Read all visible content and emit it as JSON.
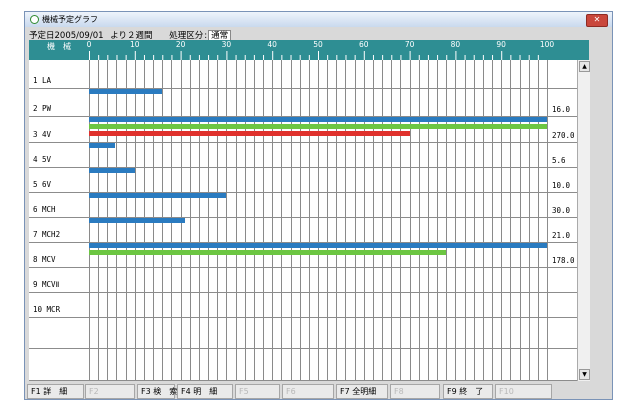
{
  "window": {
    "title": "機械予定グラフ",
    "close_icon": "close-icon"
  },
  "info": {
    "date_label": "予定日",
    "date": "2005/09/01",
    "period": "より２週間",
    "category_label": "処理区分",
    "category_value": "通常"
  },
  "grid": {
    "header_label": "機　械",
    "scale_labels": [
      "0",
      "10",
      "20",
      "30",
      "40",
      "50",
      "60",
      "70",
      "80",
      "90",
      "100"
    ],
    "colors": {
      "header": "#2e8e93",
      "blue": "#2a7bc0",
      "green": "#6cc642",
      "red": "#e0312d"
    },
    "rows": [
      {
        "label": "1 LA",
        "value": "",
        "bars": []
      },
      {
        "label": "2 PW",
        "value": "16.0",
        "bars": [
          {
            "color": "blue",
            "percent": 16
          }
        ]
      },
      {
        "label": "3 4V",
        "value": "270.0",
        "bars": [
          {
            "color": "blue",
            "percent": 100
          },
          {
            "color": "green",
            "percent": 100
          },
          {
            "color": "red",
            "percent": 70
          }
        ]
      },
      {
        "label": "4 5V",
        "value": "5.6",
        "bars": [
          {
            "color": "blue",
            "percent": 5.6
          }
        ]
      },
      {
        "label": "5 6V",
        "value": "10.0",
        "bars": [
          {
            "color": "blue",
            "percent": 10
          }
        ]
      },
      {
        "label": "6 MCH",
        "value": "30.0",
        "bars": [
          {
            "color": "blue",
            "percent": 30
          }
        ]
      },
      {
        "label": "7 MCH2",
        "value": "21.0",
        "bars": [
          {
            "color": "blue",
            "percent": 21
          }
        ]
      },
      {
        "label": "8 MCV",
        "value": "178.0",
        "bars": [
          {
            "color": "blue",
            "percent": 100
          },
          {
            "color": "green",
            "percent": 78
          }
        ]
      },
      {
        "label": "9 MCVⅡ",
        "value": "",
        "bars": []
      },
      {
        "label": "10 MCR",
        "value": "",
        "bars": []
      },
      {
        "label": "",
        "value": "",
        "bars": []
      },
      {
        "label": "",
        "value": "",
        "bars": []
      }
    ]
  },
  "function_keys": [
    {
      "label": "F1 詳　細",
      "enabled": true
    },
    {
      "label": "F2",
      "enabled": false
    },
    {
      "label": "F3 検　索",
      "enabled": true
    },
    {
      "label": "F4 明　細",
      "enabled": true
    },
    {
      "label": "F5",
      "enabled": false
    },
    {
      "label": "F6",
      "enabled": false
    },
    {
      "label": "F7 全明細",
      "enabled": true
    },
    {
      "label": "F8",
      "enabled": false
    },
    {
      "label": "F9 終　了",
      "enabled": true
    },
    {
      "label": "F10",
      "enabled": false
    }
  ]
}
